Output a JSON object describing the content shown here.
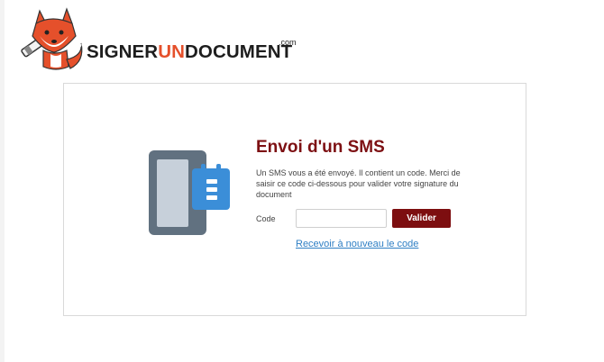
{
  "brand": {
    "name_part1": "SIGNER",
    "name_part2": "UN",
    "name_part3": "DOCUMENT",
    "tld": ".com",
    "accent_color": "#e5502b",
    "mascot_icon": "fox-pen-icon"
  },
  "sms_card": {
    "illustration_icon": "phone-notepad-icon",
    "title": "Envoi d'un SMS",
    "description": "Un SMS vous a été envoyé. Il contient un code. Merci de saisir ce code ci-dessous pour valider votre signature du document",
    "code_label": "Code",
    "code_value": "",
    "code_placeholder": "",
    "validate_label": "Valider",
    "resend_link": "Recevoir à nouveau le code",
    "title_color": "#7d1013",
    "button_color": "#7d0e10",
    "link_color": "#2f7fc4"
  }
}
